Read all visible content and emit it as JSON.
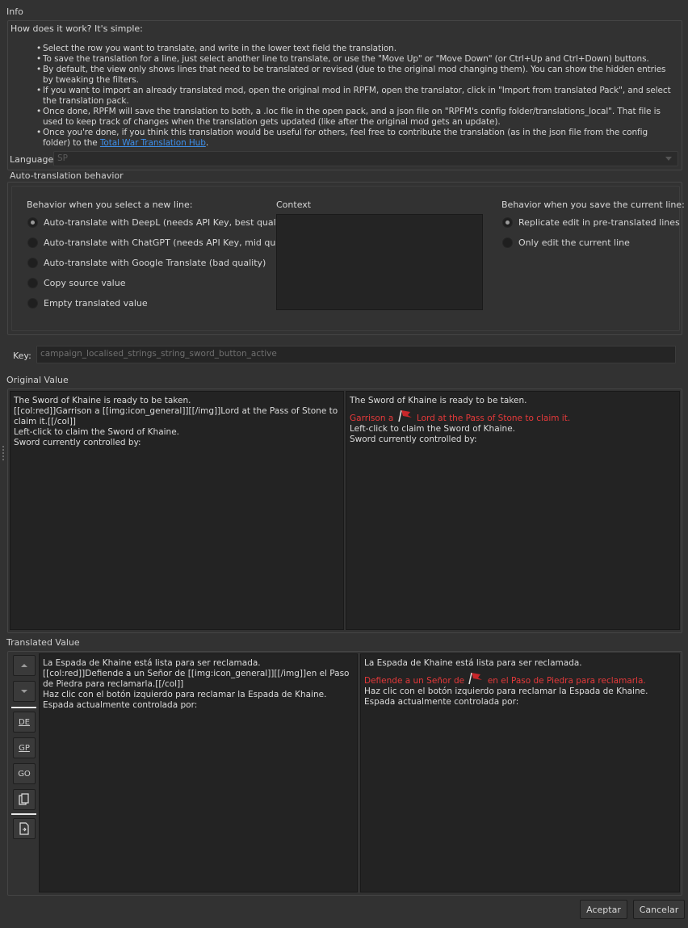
{
  "info": {
    "group_title": "Info",
    "how_title": "How does it work? It's simple:",
    "bullets": [
      "Select the row you want to translate, and write in the lower text field the translation.",
      "To save the translation for a line, just select another line to translate, or use the \"Move Up\" or \"Move Down\" (or Ctrl+Up and Ctrl+Down) buttons.",
      "By default, the view only shows lines that need to be translated or revised (due to the original mod changing them). You can show the hidden entries by tweaking the filters.",
      "If you want to import an already translated mod, open the original mod in RPFM, open the translator, click in \"Import from translated Pack\", and select the translation pack.",
      "Once done, RPFM will save the translation to both, a .loc file in the open pack, and a json file on \"RPFM's config folder/translations_local\". That file is used to keep track of changes when the translation gets updated (like after the original mod gets an update).",
      "Once you're done, if you think this translation would be useful for others, feel free to contribute the translation (as in the json file from the config folder) to the "
    ],
    "hub_link": "Total War Translation Hub",
    "hub_suffix": ".",
    "language_label": "Language:",
    "language_value": "SP"
  },
  "auto": {
    "group_title": "Auto-translation behavior",
    "new_line_title": "Behavior when you select a new line:",
    "new_line_options": [
      {
        "label": "Auto-translate with DeepL (needs API Key, best quality)",
        "selected": true
      },
      {
        "label": "Auto-translate with ChatGPT (needs API Key, mid quality)",
        "selected": false
      },
      {
        "label": "Auto-translate with Google Translate (bad quality)",
        "selected": false
      },
      {
        "label": "Copy source value",
        "selected": false
      },
      {
        "label": "Empty translated value",
        "selected": false
      }
    ],
    "context_title": "Context",
    "save_title": "Behavior when you save the current line:",
    "save_options": [
      {
        "label": "Replicate edit in pre-translated lines",
        "selected": true
      },
      {
        "label": "Only edit the current line",
        "selected": false
      }
    ]
  },
  "key": {
    "label": "Key:",
    "value": "campaign_localised_strings_string_sword_button_active"
  },
  "original": {
    "group_title": "Original Value",
    "raw_text": "The Sword of Khaine is ready to be taken.\n[[col:red]]Garrison a [[img:icon_general]][[/img]]Lord at the Pass of Stone to claim it.[[/col]]\nLeft-click to claim the Sword of Khaine.\nSword currently controlled by:",
    "preview_line1": "The Sword of Khaine is ready to be taken.",
    "preview_red_a": "Garrison a",
    "preview_red_b": "Lord at the Pass of Stone to claim it.",
    "preview_line3": "Left-click to claim the Sword of Khaine.",
    "preview_line4": "Sword currently controlled by:"
  },
  "translated": {
    "group_title": "Translated Value",
    "raw_text": "La Espada de Khaine está lista para ser reclamada.\n[[col:red]]Defiende a un Señor de [[img:icon_general]][[/img]]en el Paso de Piedra para reclamarla.[[/col]]\nHaz clic con el botón izquierdo para reclamar la Espada de Khaine.\nEspada actualmente controlada por:",
    "preview_line1": "La Espada de Khaine está lista para ser reclamada.",
    "preview_red_a": "Defiende a un Señor de",
    "preview_red_b": "en el Paso de Piedra para reclamarla.",
    "preview_line3": "Haz clic con el botón izquierdo para reclamar la Espada de Khaine.",
    "preview_line4": "Espada actualmente controlada por:"
  },
  "toolbar": {
    "de_label": "DE",
    "gp_label": "GP",
    "go_label": "GO"
  },
  "buttons": {
    "accept": "Aceptar",
    "cancel": "Cancelar"
  },
  "icons": {
    "move_up": "arrow-up-icon",
    "move_down": "arrow-down-icon",
    "copy_source": "copy-icon",
    "import": "import-file-icon",
    "general": "red-flag-icon"
  }
}
